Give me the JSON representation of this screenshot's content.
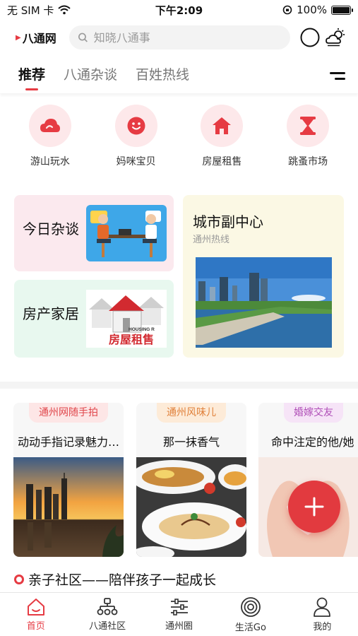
{
  "status": {
    "carrier": "无 SIM 卡",
    "time": "下午2:09",
    "battery": "100%",
    "battery_level": 1.0
  },
  "header": {
    "logo": "八通网",
    "search_placeholder": "知晓八通事"
  },
  "tabs": [
    {
      "label": "推荐",
      "active": true
    },
    {
      "label": "八通杂谈",
      "active": false
    },
    {
      "label": "百姓热线",
      "active": false
    }
  ],
  "categories": [
    {
      "label": "游山玩水",
      "icon": "cloud-icon"
    },
    {
      "label": "妈咪宝贝",
      "icon": "smile-icon"
    },
    {
      "label": "房屋租售",
      "icon": "house-icon"
    },
    {
      "label": "跳蚤市场",
      "icon": "hourglass-icon"
    }
  ],
  "features": {
    "chat": {
      "title": "今日杂谈"
    },
    "home": {
      "title": "房产家居",
      "img_small": "HOUSING R",
      "img_big": "房屋租售"
    },
    "city": {
      "title": "城市副中心",
      "subtitle": "通州热线"
    }
  },
  "topics": [
    {
      "badge": "通州网随手拍",
      "title": "动动手指记录魅力…"
    },
    {
      "badge": "通州风味儿",
      "title": "那一抹香气"
    },
    {
      "badge": "婚嫁交友",
      "title": "命中注定的他/她"
    }
  ],
  "section": {
    "title": "亲子社区——陪伴孩子一起成长"
  },
  "tabbar": [
    {
      "label": "首页",
      "icon": "home-icon",
      "active": true
    },
    {
      "label": "八通社区",
      "icon": "community-icon",
      "active": false
    },
    {
      "label": "通州圈",
      "icon": "sliders-icon",
      "active": false
    },
    {
      "label": "生活Go",
      "icon": "target-icon",
      "active": false
    },
    {
      "label": "我的",
      "icon": "person-icon",
      "active": false
    }
  ],
  "colors": {
    "accent": "#e63b43",
    "pink_bg": "#fde8ea"
  }
}
